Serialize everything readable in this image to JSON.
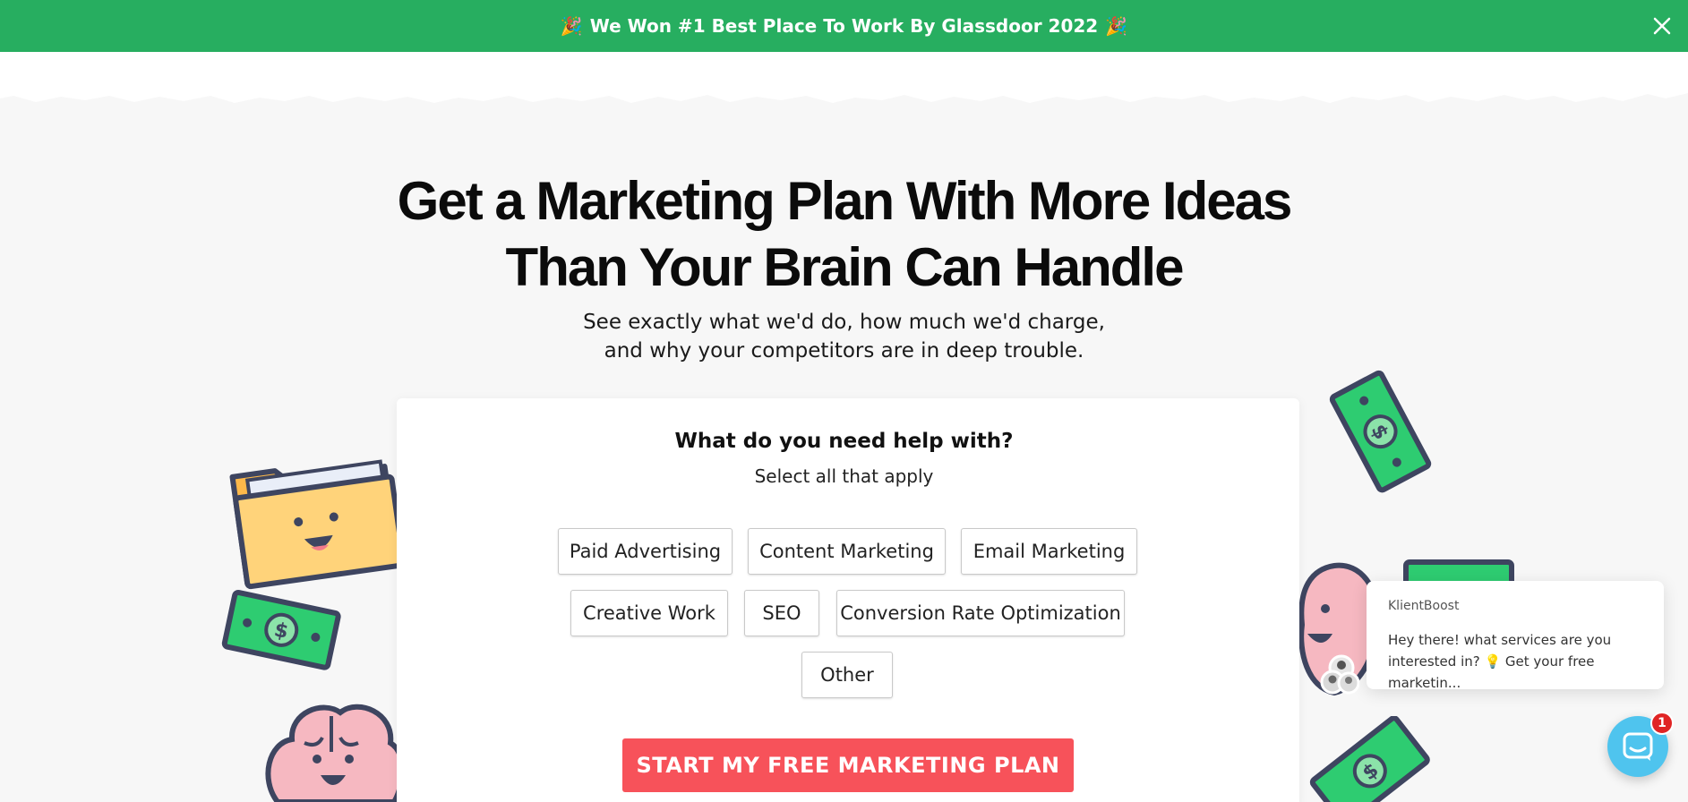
{
  "banner": {
    "text": "We Won #1 Best Place To Work By Glassdoor 2022",
    "left_emoji": "🎉",
    "right_emoji": "🎉",
    "close_icon": "close-icon",
    "color": "#27ae60"
  },
  "hero": {
    "headline_line1": "Get a Marketing Plan With More Ideas",
    "headline_line2": "Than Your Brain Can Handle",
    "subtitle_line1": "See exactly what we'd do, how much we'd charge,",
    "subtitle_line2": "and why your competitors are in deep trouble."
  },
  "form": {
    "question": "What do you need help with?",
    "hint": "Select all that apply",
    "options": [
      "Paid Advertising",
      "Content Marketing",
      "Email Marketing",
      "Creative Work",
      "SEO",
      "Conversion Rate Optimization",
      "Other"
    ],
    "cta_label": "START MY FREE MARKETING PLAN",
    "cta_color": "#f7525a"
  },
  "chat": {
    "sender": "KlientBoost",
    "message_line1": "Hey there! what services are you",
    "message_line2": "interested in? 💡 Get your free marketin...",
    "unread_count": "1",
    "launcher_icon": "chat-icon",
    "launcher_color": "#4fc4ee"
  },
  "decorations": {
    "icons": [
      "folder-character-icon",
      "money-bill-icon",
      "brain-character-icon"
    ]
  }
}
